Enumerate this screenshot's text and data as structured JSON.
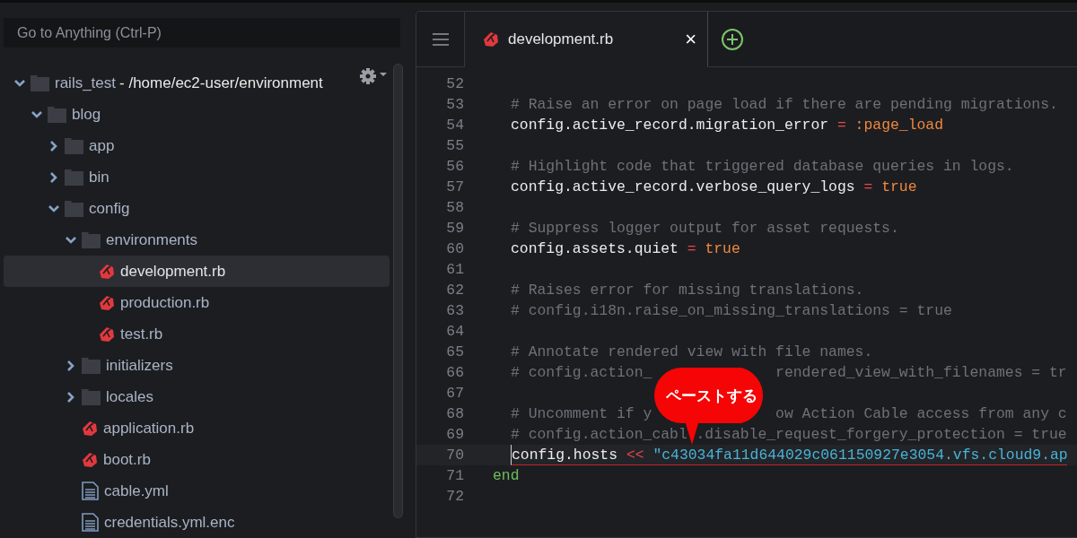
{
  "sidebar": {
    "search": {
      "placeholder": "Go to Anything (Ctrl-P)"
    },
    "tree": [
      {
        "name": "rails_test",
        "path": "- /home/ec2-user/environment",
        "kind": "folder",
        "expanded": true,
        "selected": false,
        "children": [
          {
            "name": "blog",
            "kind": "folder",
            "expanded": true,
            "selected": false,
            "children": [
              {
                "name": "app",
                "kind": "folder",
                "expanded": false,
                "selected": false
              },
              {
                "name": "bin",
                "kind": "folder",
                "expanded": false,
                "selected": false
              },
              {
                "name": "config",
                "kind": "folder",
                "expanded": true,
                "selected": false,
                "children": [
                  {
                    "name": "environments",
                    "kind": "folder",
                    "expanded": true,
                    "selected": false,
                    "children": [
                      {
                        "name": "development.rb",
                        "kind": "ruby",
                        "selected": true
                      },
                      {
                        "name": "production.rb",
                        "kind": "ruby",
                        "selected": false
                      },
                      {
                        "name": "test.rb",
                        "kind": "ruby",
                        "selected": false
                      }
                    ]
                  },
                  {
                    "name": "initializers",
                    "kind": "folder",
                    "expanded": false,
                    "selected": false
                  },
                  {
                    "name": "locales",
                    "kind": "folder",
                    "expanded": false,
                    "selected": false
                  },
                  {
                    "name": "application.rb",
                    "kind": "ruby",
                    "selected": false
                  },
                  {
                    "name": "boot.rb",
                    "kind": "ruby",
                    "selected": false
                  },
                  {
                    "name": "cable.yml",
                    "kind": "file",
                    "selected": false
                  },
                  {
                    "name": "credentials.yml.enc",
                    "kind": "file",
                    "selected": false
                  }
                ]
              }
            ]
          }
        ]
      }
    ]
  },
  "editor": {
    "tabs": [
      {
        "label": "development.rb",
        "kind": "ruby",
        "selected": true,
        "close": "×"
      }
    ],
    "lines": [
      {
        "number": "52",
        "active": false
      },
      {
        "number": "53",
        "active": false,
        "indented": true,
        "tokens": [
          {
            "kind": "comment",
            "text": "# Raise an error on page load if there are pending migrations."
          }
        ]
      },
      {
        "number": "54",
        "active": false,
        "indented": true,
        "tokens": [
          {
            "kind": "code",
            "text": "config.active_record.migration_error "
          },
          {
            "kind": "operator",
            "text": "="
          },
          {
            "kind": "value",
            "text": " :page_load"
          }
        ]
      },
      {
        "number": "55",
        "active": false
      },
      {
        "number": "56",
        "active": false,
        "indented": true,
        "tokens": [
          {
            "kind": "comment",
            "text": "# Highlight code that triggered database queries in logs."
          }
        ]
      },
      {
        "number": "57",
        "active": false,
        "indented": true,
        "tokens": [
          {
            "kind": "code",
            "text": "config.active_record.verbose_query_logs "
          },
          {
            "kind": "operator",
            "text": "="
          },
          {
            "kind": "value",
            "text": " true"
          }
        ]
      },
      {
        "number": "58",
        "active": false
      },
      {
        "number": "59",
        "active": false,
        "indented": true,
        "tokens": [
          {
            "kind": "comment",
            "text": "# Suppress logger output for asset requests."
          }
        ]
      },
      {
        "number": "60",
        "active": false,
        "indented": true,
        "tokens": [
          {
            "kind": "code",
            "text": "config.assets.quiet "
          },
          {
            "kind": "operator",
            "text": "="
          },
          {
            "kind": "value",
            "text": " true"
          }
        ]
      },
      {
        "number": "61",
        "active": false
      },
      {
        "number": "62",
        "active": false,
        "indented": true,
        "tokens": [
          {
            "kind": "comment",
            "text": "# Raises error for missing translations."
          }
        ]
      },
      {
        "number": "63",
        "active": false,
        "indented": true,
        "tokens": [
          {
            "kind": "comment",
            "text": "# config.i18n.raise_on_missing_translations = true"
          }
        ]
      },
      {
        "number": "64",
        "active": false
      },
      {
        "number": "65",
        "active": false,
        "indented": true,
        "tokens": [
          {
            "kind": "comment",
            "text": "# Annotate rendered view with file names."
          }
        ]
      },
      {
        "number": "66",
        "active": false,
        "indented": true,
        "tokens": [
          {
            "kind": "comment",
            "text": "# config.action_"
          },
          {
            "kind": "comment_tail",
            "text": "rendered_view_with_filenames = tr"
          }
        ]
      },
      {
        "number": "67",
        "active": false
      },
      {
        "number": "68",
        "active": false,
        "indented": true,
        "tokens": [
          {
            "kind": "comment",
            "text": "# Uncomment if y"
          },
          {
            "kind": "comment_tail",
            "text": "ow Action Cable access from any c"
          }
        ]
      },
      {
        "number": "69",
        "active": false,
        "indented": true,
        "tokens": [
          {
            "kind": "comment",
            "text": "# config.action_cabl"
          },
          {
            "kind": "comment_tail",
            "text": ".disable_request_forgery_protection = true"
          }
        ]
      },
      {
        "number": "70",
        "active": true,
        "indented": true,
        "tokens": [
          {
            "kind": "code",
            "text": "config.hosts "
          },
          {
            "kind": "operator",
            "text": "<<"
          },
          {
            "kind": "string",
            "text": " \"c43034fa11d644029c061150927e3054.vfs.cloud9.ap"
          }
        ]
      },
      {
        "number": "71",
        "active": false,
        "tokens": [
          {
            "kind": "keyword",
            "text": "end"
          }
        ]
      },
      {
        "number": "72",
        "active": false
      }
    ],
    "callout": {
      "text": "ペーストする"
    }
  }
}
